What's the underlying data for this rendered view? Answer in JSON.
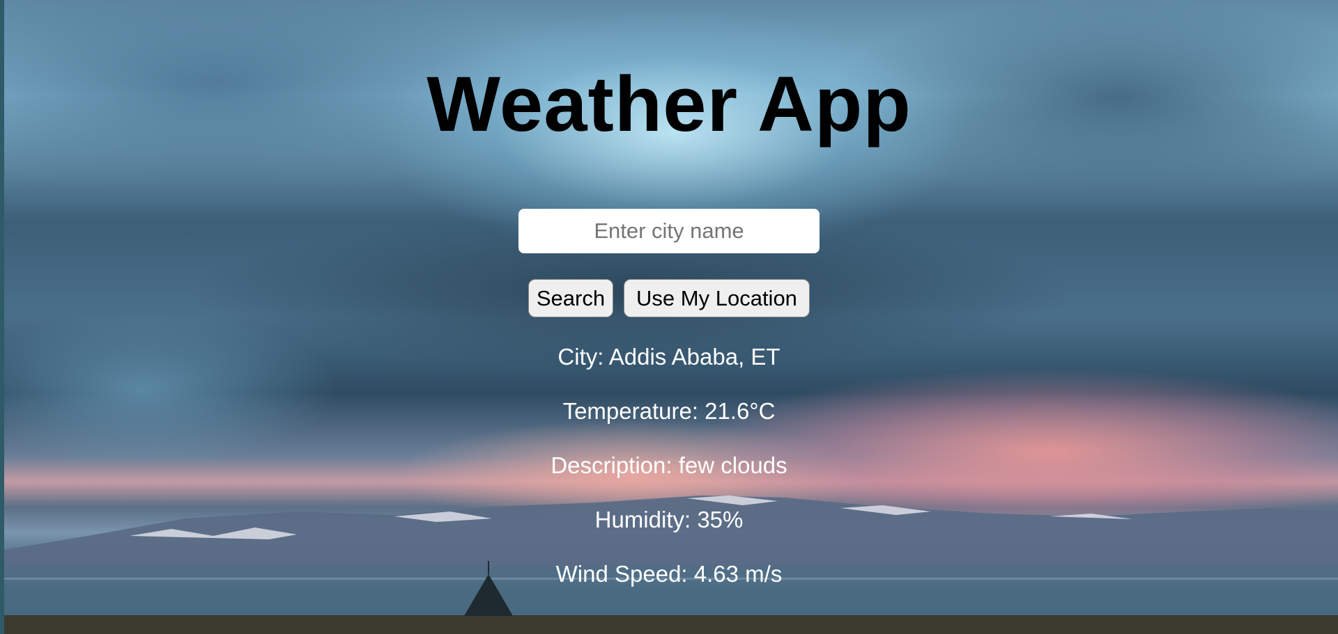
{
  "app": {
    "title": "Weather App"
  },
  "search": {
    "placeholder": "Enter city name",
    "value": ""
  },
  "buttons": {
    "search_label": "Search",
    "location_label": "Use My Location"
  },
  "weather": {
    "city": "City: Addis Ababa, ET",
    "temperature": "Temperature: 21.6°C",
    "description": "Description: few clouds",
    "humidity": "Humidity: 35%",
    "wind_speed": "Wind Speed: 4.63 m/s"
  }
}
